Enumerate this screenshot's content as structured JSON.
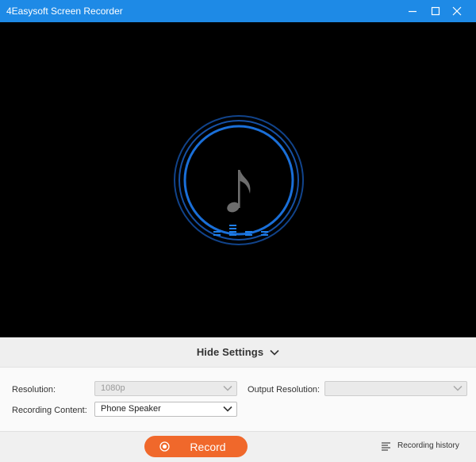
{
  "window": {
    "title": "4Easysoft Screen Recorder"
  },
  "settings_toggle": {
    "label": "Hide Settings"
  },
  "settings": {
    "resolution_label": "Resolution:",
    "resolution_value": "1080p",
    "output_resolution_label": "Output Resolution:",
    "output_resolution_value": "",
    "recording_content_label": "Recording Content:",
    "recording_content_value": "Phone Speaker"
  },
  "actions": {
    "record_label": "Record",
    "history_label": "Recording history"
  },
  "colors": {
    "titlebar": "#1e8ae6",
    "accent_blue": "#1a6fd8",
    "record_orange": "#f0682b",
    "preview_bg": "#000000"
  },
  "icons": [
    "minimize-icon",
    "maximize-icon",
    "close-icon",
    "music-note-icon",
    "equalizer-icon",
    "chevron-down-icon",
    "record-dot-icon",
    "list-icon"
  ]
}
